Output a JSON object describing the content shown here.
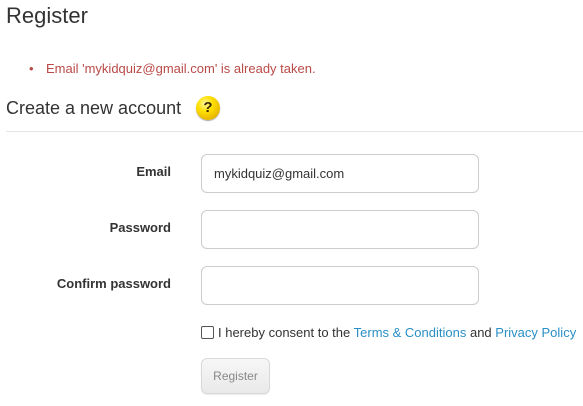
{
  "page": {
    "title": "Register"
  },
  "errors": [
    {
      "bullet": "•",
      "message": "Email 'mykidquiz@gmail.com' is already taken."
    }
  ],
  "form": {
    "subtitle": "Create a new account",
    "help_icon": {
      "name": "question-mark-icon",
      "glyph": "?"
    },
    "email": {
      "label": "Email",
      "value": "mykidquiz@gmail.com",
      "placeholder": ""
    },
    "password": {
      "label": "Password",
      "value": "",
      "placeholder": ""
    },
    "confirm_password": {
      "label": "Confirm password",
      "value": "",
      "placeholder": ""
    },
    "consent": {
      "checked": false,
      "prefix": "I hereby consent to the ",
      "terms_link": "Terms & Conditions",
      "conjunction": " and ",
      "privacy_link": "Privacy Policy"
    },
    "submit_label": "Register"
  },
  "colors": {
    "error": "#b94a48",
    "link": "#2a8fc7",
    "help_icon": "#ffe000",
    "text": "#333333"
  }
}
